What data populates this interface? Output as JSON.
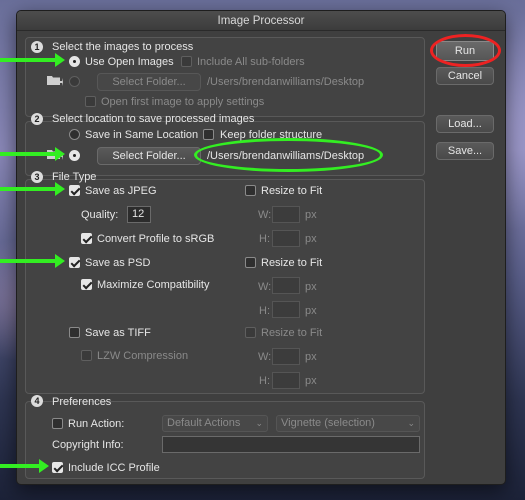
{
  "window": {
    "title": "Image Processor"
  },
  "section1": {
    "number": "1",
    "title": "Select the images to process",
    "use_open_images": "Use Open Images",
    "include_subfolders": "Include All sub-folders",
    "select_folder": "Select Folder...",
    "folder_path": "/Users/brendanwilliams/Desktop",
    "open_first": "Open first image to apply settings"
  },
  "section2": {
    "number": "2",
    "title": "Select location to save processed images",
    "save_same": "Save in Same Location",
    "keep_structure": "Keep folder structure",
    "select_folder": "Select Folder...",
    "folder_path": "/Users/brendanwilliams/Desktop"
  },
  "section3": {
    "number": "3",
    "title": "File Type",
    "save_jpeg": "Save as JPEG",
    "resize_to_fit": "Resize to Fit",
    "quality_label": "Quality:",
    "quality_value": "12",
    "w_label": "W:",
    "h_label": "H:",
    "px": "px",
    "convert_srgb": "Convert Profile to sRGB",
    "save_psd": "Save as PSD",
    "max_compat": "Maximize Compatibility",
    "save_tiff": "Save as TIFF",
    "lzw": "LZW Compression"
  },
  "section4": {
    "number": "4",
    "title": "Preferences",
    "run_action": "Run Action:",
    "action_set": "Default Actions",
    "action": "Vignette (selection)",
    "copyright": "Copyright Info:",
    "include_icc": "Include ICC Profile"
  },
  "buttons": {
    "run": "Run",
    "cancel": "Cancel",
    "load": "Load...",
    "save": "Save..."
  },
  "colors": {
    "annotation_green": "#33ee22",
    "annotation_red": "#ee2222"
  }
}
